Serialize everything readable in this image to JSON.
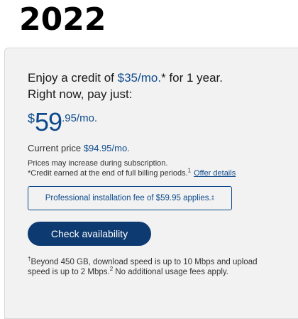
{
  "heading": "2022",
  "offer": {
    "line1_prefix": "Enjoy a credit of ",
    "credit_amount": "$35/mo.",
    "line1_suffix": "* for 1 year.",
    "line2": "Right now, pay just:",
    "price_currency": "$",
    "price_whole": "59",
    "price_rest": ".95/mo.",
    "current_price_label": "Current price ",
    "current_price_value": "$94.95/mo.",
    "fine_line1": "Prices may increase during subscription.",
    "fine_line2": "*Credit earned at the end of full billing periods.",
    "fine_sup": "1",
    "offer_details_link": "Offer details",
    "installation_fee": "Professional installation fee of $59.95 applies.",
    "installation_fee_sup": "‡",
    "check_button": "Check availability",
    "footnote_sup1": "†",
    "footnote_part1": "Beyond 450 GB, download speed is up to 10 Mbps and upload speed is up to 2 Mbps.",
    "footnote_sup2": "2",
    "footnote_part2": " No additional usage fees apply."
  },
  "colors": {
    "accent": "#0d4a8c",
    "button": "#0d3a70",
    "card_background": "#f2f2f2"
  }
}
